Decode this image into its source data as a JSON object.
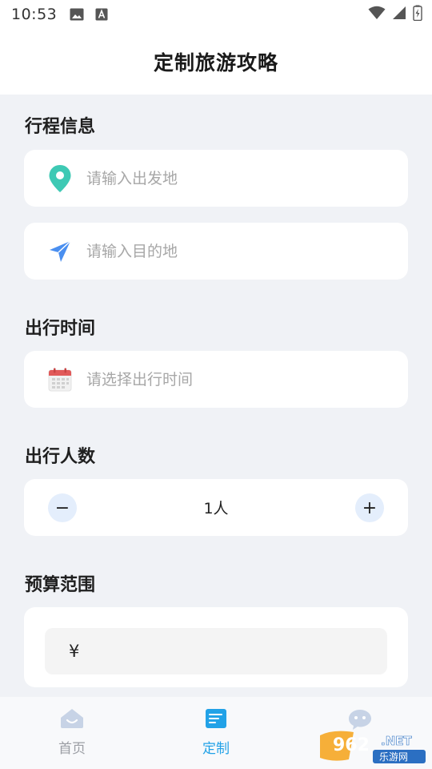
{
  "status_bar": {
    "time": "10:53"
  },
  "header": {
    "title": "定制旅游攻略"
  },
  "itinerary": {
    "title": "行程信息",
    "departure_placeholder": "请输入出发地",
    "destination_placeholder": "请输入目的地"
  },
  "travel_time": {
    "title": "出行时间",
    "placeholder": "请选择出行时间"
  },
  "travelers": {
    "title": "出行人数",
    "value": "1人",
    "minus": "−",
    "plus": "+"
  },
  "budget": {
    "title": "预算范围",
    "currency_symbol": "¥"
  },
  "tabbar": {
    "tabs": [
      {
        "label": "首页",
        "icon": "home-icon",
        "active": false
      },
      {
        "label": "定制",
        "icon": "document-icon",
        "active": true
      },
      {
        "label": "",
        "icon": "chat-icon",
        "active": false
      }
    ]
  },
  "watermark": {
    "text": "962 .NET",
    "subtext": "乐游网"
  },
  "colors": {
    "accent": "#22a2e7",
    "location_pin": "#3ec9b4",
    "navigation_arrow": "#4a8ff0",
    "calendar": "#e15a5a"
  }
}
